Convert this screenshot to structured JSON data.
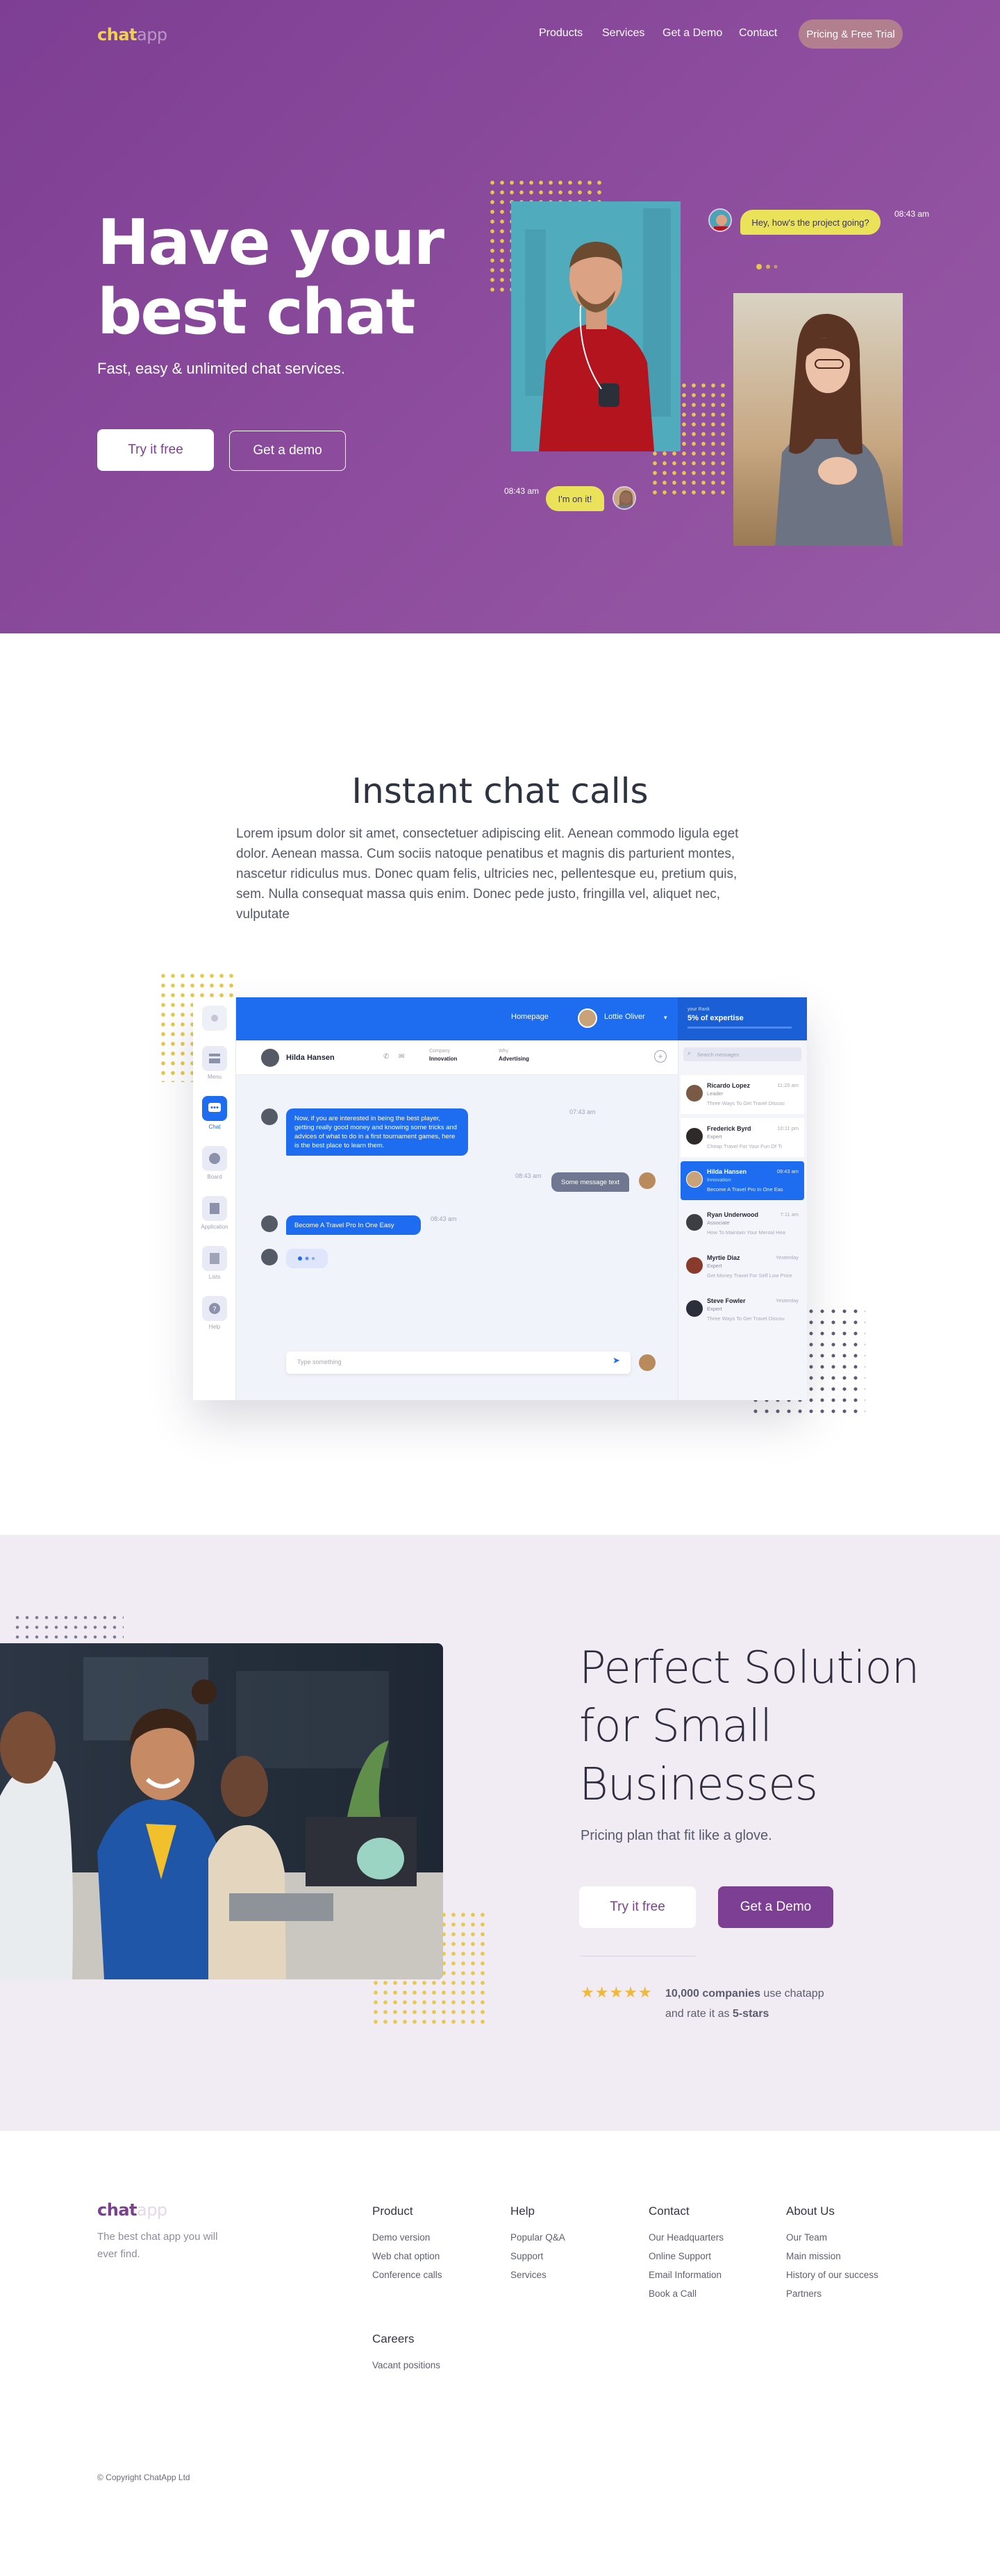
{
  "nav": {
    "logo_a": "chat",
    "logo_b": "app",
    "links": [
      "Products",
      "Services",
      "Get a Demo",
      "Contact"
    ],
    "cta": "Pricing & Free Trial"
  },
  "hero": {
    "title_line1": "Have your",
    "title_line2": "best chat",
    "subtitle": "Fast, easy & unlimited chat services.",
    "btn_primary": "Try it free",
    "btn_secondary": "Get a demo",
    "bubble_top": "Hey, how's the project going?",
    "bubble_top_time": "08:43 am",
    "bubble_bottom": "I'm on it!",
    "bubble_bottom_time": "08:43 am"
  },
  "instant": {
    "title": "Instant chat calls",
    "body": "Lorem ipsum dolor sit amet, consectetuer adipiscing elit. Aenean commodo ligula eget dolor. Aenean massa. Cum sociis natoque penatibus et magnis dis parturient montes, nascetur ridiculus mus. Donec quam felis, ultricies nec, pellentesque eu, pretium quis, sem. Nulla consequat massa quis enim. Donec pede justo, fringilla vel, aliquet nec, vulputate"
  },
  "mockup": {
    "top_home": "Homepage",
    "top_user": "Lottie Oliver",
    "top_rank_label": "your Rank",
    "top_rank_value": "5% of expertise",
    "chat_name": "Hilda Hansen",
    "company_label": "Company",
    "company_value": "Innovation",
    "why_label": "Why",
    "why_value": "Advertising",
    "msg1": "Now, if you are interested in being the best player, getting really good money and knowing some tricks and advices of what to do in a first tournament games, here is the best place to learn them.",
    "msg1_time": "07:43 am",
    "msg2": "Some message text",
    "msg2_time": "08:43 am",
    "msg3": "Become A Travel Pro In One Easy",
    "msg3_time": "08:43 am",
    "input_placeholder": "Type something",
    "search_placeholder": "Search messages",
    "side_labels": [
      "Menu",
      "Chat",
      "Board",
      "Application",
      "Lists",
      "Help"
    ],
    "contacts": [
      {
        "name": "Ricardo Lopez",
        "role": "Leader",
        "msg": "Three Ways To Get Travel Discou",
        "time": "11:20 am"
      },
      {
        "name": "Frederick Byrd",
        "role": "Expert",
        "msg": "Cheap Travel For Your Fun Of Ti",
        "time": "10:11 pm"
      },
      {
        "name": "Hilda Hansen",
        "role": "Innovation",
        "msg": "Become A Travel Pro In One Eas",
        "time": "09:43 am"
      },
      {
        "name": "Ryan Underwood",
        "role": "Associate",
        "msg": "How To Maintain Your Mental Hea",
        "time": "7:11 am"
      },
      {
        "name": "Myrtie Diaz",
        "role": "Expert",
        "msg": "Get Money Travel For Self Low Price",
        "time": "Yesterday"
      },
      {
        "name": "Steve Fowler",
        "role": "Expert",
        "msg": "Three Ways To Get Travel Discou",
        "time": "Yesterday"
      }
    ]
  },
  "solution": {
    "title_line1": "Perfect Solution",
    "title_line2": "for Small",
    "title_line3": "Businesses",
    "subtitle": "Pricing plan that fit like a glove.",
    "btn_primary": "Try it free",
    "btn_secondary": "Get a Demo",
    "stars": "★★★★★",
    "rating_count": "10,000 companies",
    "rating_text1": " use chatapp",
    "rating_text2": "and rate it as ",
    "rating_value": "5-stars",
    "rating_stars": 5
  },
  "footer": {
    "logo_a": "chat",
    "logo_b": "app",
    "tagline": "The best chat app you will ever find.",
    "columns": [
      {
        "title": "Product",
        "links": [
          "Demo version",
          "Web chat option",
          "Conference calls"
        ]
      },
      {
        "title": "Help",
        "links": [
          "Popular Q&A",
          "Support",
          "Services"
        ]
      },
      {
        "title": "Contact",
        "links": [
          "Our Headquarters",
          "Online Support",
          "Email Information",
          "Book a Call"
        ]
      },
      {
        "title": "About Us",
        "links": [
          "Our Team",
          "Main mission",
          "History of our success",
          "Partners"
        ]
      },
      {
        "title": "Careers",
        "links": [
          "Vacant positions"
        ]
      }
    ],
    "copyright": "© Copyright ChatApp Ltd"
  },
  "colors": {
    "brand_purple": "#7d3f93",
    "accent_yellow": "#f0d34a",
    "chat_blue": "#1e6cf0"
  }
}
